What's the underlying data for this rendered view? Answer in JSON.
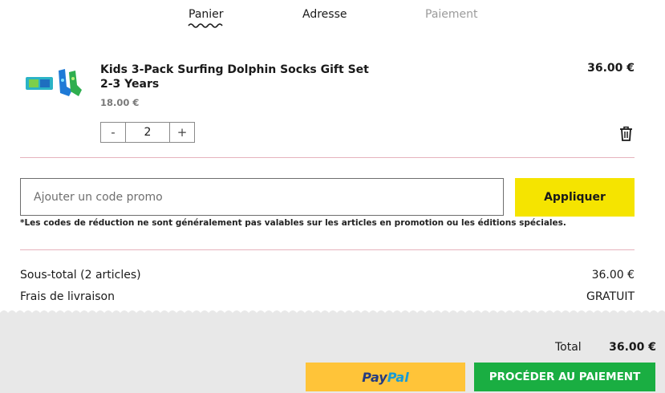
{
  "steps": {
    "cart": "Panier",
    "address": "Adresse",
    "payment": "Paiement"
  },
  "cart_item": {
    "title": "Kids 3-Pack Surfing Dolphin Socks Gift Set",
    "size": "2-3 Years",
    "unit_price": "18.00 €",
    "line_price": "36.00 €",
    "quantity": "2",
    "qty_minus": "-",
    "qty_plus": "+"
  },
  "promo": {
    "placeholder": "Ajouter un code promo",
    "apply_label": "Appliquer",
    "note": "*Les codes de réduction ne sont généralement pas valables sur les articles en promotion ou les éditions spéciales."
  },
  "summary": {
    "subtotal_label": "Sous-total (2 articles)",
    "subtotal_value": "36.00 €",
    "shipping_label": "Frais de livraison",
    "shipping_value": "GRATUIT"
  },
  "footer": {
    "total_label": "Total",
    "total_value": "36.00 €",
    "paypal_part1": "Pay",
    "paypal_part2": "Pal",
    "checkout_label": "PROCÉDER AU PAIEMENT"
  },
  "colors": {
    "accent_yellow": "#f5e400",
    "checkout_green": "#1aae42",
    "paypal_yellow": "#ffc439",
    "divider_pink": "#e6b3bd"
  }
}
